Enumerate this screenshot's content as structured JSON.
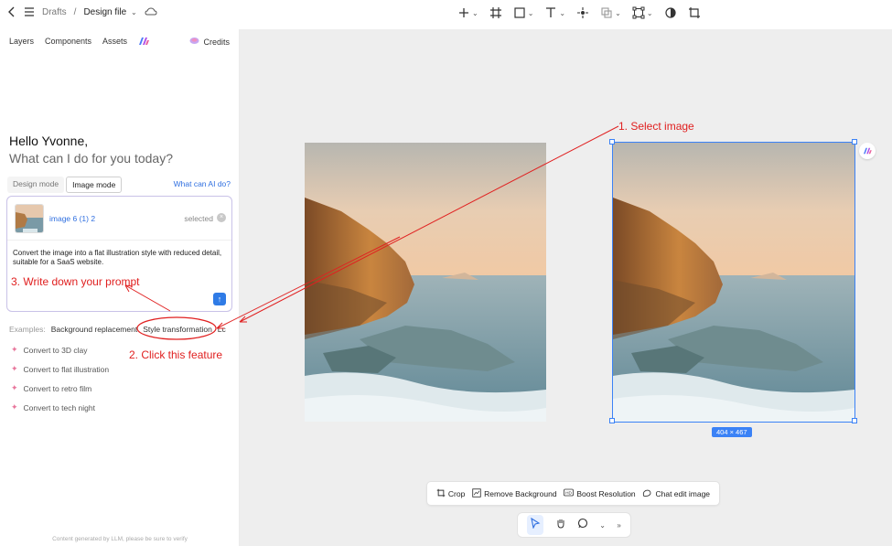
{
  "topbar": {
    "breadcrumb_root": "Drafts",
    "breadcrumb_sep": "/",
    "file_name": "Design file"
  },
  "left_panel": {
    "tabs": [
      "Layers",
      "Components",
      "Assets"
    ],
    "credits_label": "Credits",
    "greeting": "Hello Yvonne,",
    "question": "What can I do for you today?",
    "modes": [
      "Design mode",
      "Image mode"
    ],
    "active_mode": "Image mode",
    "what_ai_link": "What can AI do?",
    "attached_image": {
      "name": "image 6 (1) 2",
      "status": "selected"
    },
    "prompt_text": "Convert the image into a flat illustration style with reduced detail, suitable for a SaaS website.",
    "examples_label": "Examples:",
    "examples": [
      "Background replacement",
      "Style transformation",
      "Lc"
    ],
    "suggestions": [
      "Convert to 3D clay",
      "Convert to flat illustration",
      "Convert to retro film",
      "Convert to tech night"
    ],
    "footer_note": "Content generated by LLM, please be sure to verify"
  },
  "canvas": {
    "selection_size": "404 × 467",
    "image_toolbar": [
      "Crop",
      "Remove Background",
      "Boost Resolution",
      "Chat edit image"
    ]
  },
  "annotations": {
    "step1": "1. Select image",
    "step2": "2. Click this feature",
    "step3": "3. Write down your prompt"
  },
  "colors": {
    "accent": "#3b82f6",
    "annotation": "#e02020",
    "link": "#2f6fe0"
  }
}
